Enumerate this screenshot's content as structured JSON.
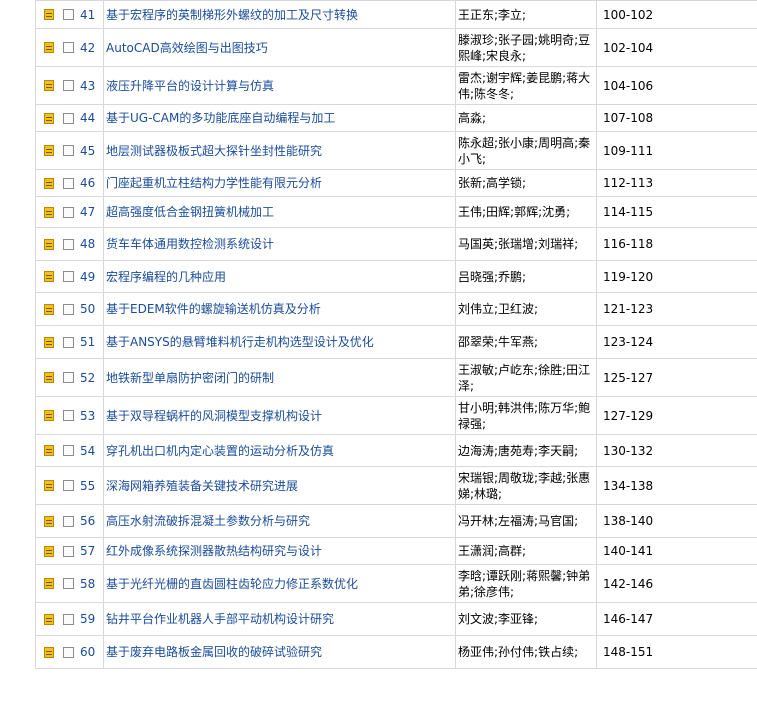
{
  "rows": [
    {
      "num": "41",
      "title": "基于宏程序的英制梯形外螺纹的加工及尺寸转换",
      "authors": "王正东;李立;",
      "pages": "100-102"
    },
    {
      "num": "42",
      "title": "AutoCAD高效绘图与出图技巧",
      "authors": "滕淑珍;张子园;姚明奇;豆熙峰;宋良永;",
      "pages": "102-104"
    },
    {
      "num": "43",
      "title": "液压升降平台的设计计算与仿真",
      "authors": "雷杰;谢宇辉;姜昆鹏;蒋大伟;陈冬冬;",
      "pages": "104-106"
    },
    {
      "num": "44",
      "title": "基于UG-CAM的多功能底座自动编程与加工",
      "authors": "高淼;",
      "pages": "107-108"
    },
    {
      "num": "45",
      "title": "地层测试器极板式超大探针坐封性能研究",
      "authors": "陈永超;张小康;周明高;秦小飞;",
      "pages": "109-111"
    },
    {
      "num": "46",
      "title": "门座起重机立柱结构力学性能有限元分析",
      "authors": "张新;高学锁;",
      "pages": "112-113"
    },
    {
      "num": "47",
      "title": "超高强度低合金钢扭簧机械加工",
      "authors": "王伟;田辉;郭辉;沈勇;",
      "pages": "114-115"
    },
    {
      "num": "48",
      "title": "货车车体通用数控检测系统设计",
      "authors": "马国英;张瑞增;刘瑞祥;",
      "pages": "116-118"
    },
    {
      "num": "49",
      "title": "宏程序编程的几种应用",
      "authors": "吕晓强;乔鹏;",
      "pages": "119-120"
    },
    {
      "num": "50",
      "title": "基于EDEM软件的螺旋输送机仿真及分析",
      "authors": "刘伟立;卫红波;",
      "pages": "121-123"
    },
    {
      "num": "51",
      "title": "基于ANSYS的悬臂堆料机行走机构选型设计及优化",
      "authors": "邵翠荣;牛军燕;",
      "pages": "123-124"
    },
    {
      "num": "52",
      "title": "地铁新型单扇防护密闭门的研制",
      "authors": "王淑敏;卢屹东;徐胜;田江泽;",
      "pages": "125-127"
    },
    {
      "num": "53",
      "title": "基于双导程蜗杆的风洞模型支撑机构设计",
      "authors": "甘小明;韩洪伟;陈万华;鲍禄强;",
      "pages": "127-129"
    },
    {
      "num": "54",
      "title": "穿孔机出口机内定心装置的运动分析及仿真",
      "authors": "边海涛;唐苑寿;李天嗣;",
      "pages": "130-132"
    },
    {
      "num": "55",
      "title": "深海网箱养殖装备关键技术研究进展",
      "authors": "宋瑞银;周敬珑;李越;张惠娣;林璐;",
      "pages": "134-138"
    },
    {
      "num": "56",
      "title": "高压水射流破拆混凝土参数分析与研究",
      "authors": "冯开林;左福涛;马官国;",
      "pages": "138-140"
    },
    {
      "num": "57",
      "title": "红外成像系统探测器散热结构研究与设计",
      "authors": "王潇润;高群;",
      "pages": "140-141"
    },
    {
      "num": "58",
      "title": "基于光纤光栅的直齿圆柱齿轮应力修正系数优化",
      "authors": "李晗;谭跃刚;蒋熙馨;钟弟弟;徐彦伟;",
      "pages": "142-146"
    },
    {
      "num": "59",
      "title": "钻井平台作业机器人手部平动机构设计研究",
      "authors": "刘文波;李亚锋;",
      "pages": "146-147"
    },
    {
      "num": "60",
      "title": "基于废弃电路板金属回收的破碎试验研究",
      "authors": "杨亚伟;孙付伟;铁占续;",
      "pages": "148-151"
    }
  ]
}
